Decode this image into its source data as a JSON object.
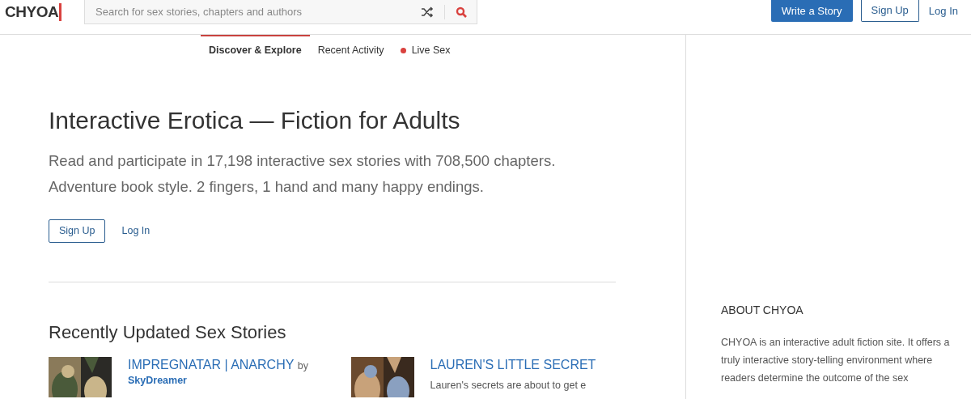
{
  "logo": "CHYOA",
  "search": {
    "placeholder": "Search for sex stories, chapters and authors"
  },
  "header_buttons": [
    {
      "label": "Write a Story",
      "kind": "primary"
    },
    {
      "label": "Sign Up",
      "kind": "outline"
    },
    {
      "label": "Log In",
      "kind": "link"
    }
  ],
  "tabs": [
    {
      "label": "Discover & Explore",
      "selected": true,
      "live": false
    },
    {
      "label": "Recent Activity",
      "selected": false,
      "live": false
    },
    {
      "label": "Live Sex",
      "selected": false,
      "live": true
    }
  ],
  "hero": {
    "title": "Interactive Erotica — Fiction for Adults",
    "lines": [
      "Read and participate in 17,198 interactive sex stories with 708,500 chapters.",
      "Adventure book style. 2 fingers, 1 hand and many happy endings."
    ],
    "buttons": [
      {
        "label": "Sign Up",
        "kind": "outline"
      },
      {
        "label": "Log In",
        "kind": "link"
      }
    ]
  },
  "section_title": "Recently Updated Sex Stories",
  "stories": [
    {
      "title": "IMPREGNATAR | ANARCHY",
      "by": "by",
      "author": "SkyDreamer",
      "kind": "picture"
    },
    {
      "title": "LAUREN'S LITTLE SECRET",
      "description": "Lauren's secrets are about to get e",
      "kind": "picture"
    }
  ],
  "sidebar": {
    "title": "ABOUT CHYOA",
    "text": "CHYOA is an interactive adult fiction site. It offers a truly interactive story-telling environment where readers determine the outcome of the sex"
  }
}
